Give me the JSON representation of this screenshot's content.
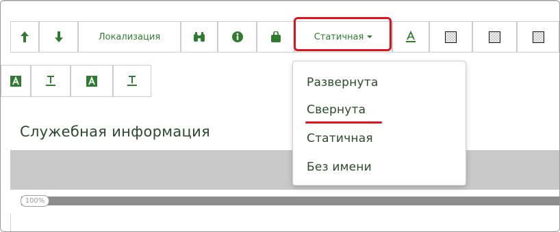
{
  "toolbar": {
    "row1": [
      {
        "name": "move-up-button",
        "type": "icon",
        "icon": "arrow-up-icon",
        "accent": "#2e7d2e"
      },
      {
        "name": "move-down-button",
        "type": "icon",
        "icon": "arrow-down-icon",
        "accent": "#2e7d2e"
      },
      {
        "name": "localization-button",
        "type": "text",
        "label": "Локализация"
      },
      {
        "name": "binoculars-button",
        "type": "icon",
        "icon": "binoculars-icon"
      },
      {
        "name": "info-button",
        "type": "icon",
        "icon": "info-icon"
      },
      {
        "name": "bag-button",
        "type": "icon",
        "icon": "bag-icon"
      },
      {
        "name": "panel-state-dropdown",
        "type": "dropdown",
        "label": "Статичная"
      },
      {
        "name": "text-style-button",
        "type": "icon",
        "icon": "text-underline-a-icon"
      },
      {
        "name": "background-button-1",
        "type": "icon",
        "icon": "checker-icon"
      },
      {
        "name": "background-button-2",
        "type": "icon",
        "icon": "checker-icon"
      },
      {
        "name": "background-button-3",
        "type": "icon",
        "icon": "checker-icon"
      }
    ],
    "row2": [
      {
        "name": "text-a-filled-button-1",
        "icon": "text-a-filled-icon"
      },
      {
        "name": "text-t-underline-button-1",
        "icon": "text-t-underline-icon"
      },
      {
        "name": "text-a-filled-button-2",
        "icon": "text-a-filled-icon"
      },
      {
        "name": "text-t-underline-button-2",
        "icon": "text-t-underline-icon"
      }
    ]
  },
  "section": {
    "title": "Служебная информация"
  },
  "progress": {
    "label": "100%",
    "value": 1.0
  },
  "dropdown_menu": {
    "items": [
      {
        "label": "Развернута"
      },
      {
        "label": "Свернута",
        "annotated": true
      },
      {
        "label": "Статичная"
      },
      {
        "label": "Без имени"
      }
    ]
  },
  "colors": {
    "accent_green": "#2e7d2e",
    "annotation_red": "#e0101e",
    "band_gray": "#c8c8c8",
    "progress_gray": "#8c8c8c"
  }
}
